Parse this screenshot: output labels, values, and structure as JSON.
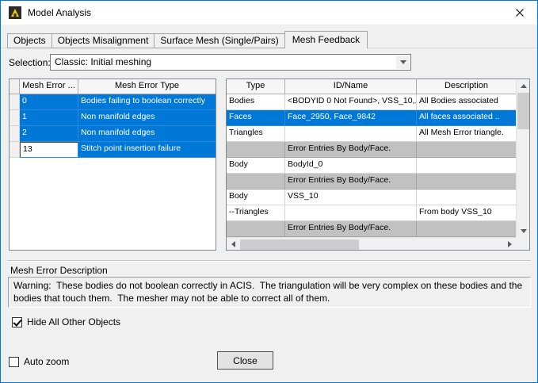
{
  "window": {
    "title": "Model Analysis"
  },
  "tabs": [
    {
      "label": "Objects",
      "active": false
    },
    {
      "label": "Objects Misalignment",
      "active": false
    },
    {
      "label": "Surface Mesh (Single/Pairs)",
      "active": false
    },
    {
      "label": "Mesh Feedback",
      "active": true
    }
  ],
  "selection": {
    "label": "Selection:",
    "value": "Classic: Initial meshing"
  },
  "left_table": {
    "headers": [
      "Mesh Error ...",
      "Mesh Error Type"
    ],
    "rows": [
      {
        "id": "0",
        "type": "Bodies failing to boolean correctly",
        "selected": true
      },
      {
        "id": "1",
        "type": "Non manifold edges",
        "selected": true
      },
      {
        "id": "2",
        "type": "Non manifold edges",
        "selected": true
      },
      {
        "id": "13",
        "type": "Stitch point insertion failure",
        "selected": true
      }
    ]
  },
  "right_table": {
    "headers": [
      "Type",
      "ID/Name",
      "Description"
    ],
    "rows": [
      {
        "type": "Bodies",
        "id": "<BODYID 0 Not Found>, VSS_10,...",
        "desc": "All Bodies associated",
        "state": "normal"
      },
      {
        "type": "Faces",
        "id": "Face_2950, Face_9842",
        "desc": "All faces associated ..",
        "state": "selected"
      },
      {
        "type": "Triangles",
        "id": "",
        "desc": "All Mesh Error triangle.",
        "state": "normal"
      },
      {
        "type": "",
        "id": "Error Entries By Body/Face.",
        "desc": "",
        "state": "section"
      },
      {
        "type": "Body",
        "id": "BodyId_0",
        "desc": "",
        "state": "normal"
      },
      {
        "type": "",
        "id": "Error Entries By Body/Face.",
        "desc": "",
        "state": "section"
      },
      {
        "type": "Body",
        "id": "VSS_10",
        "desc": "",
        "state": "normal"
      },
      {
        "type": "--Triangles",
        "id": "",
        "desc": "From body VSS_10",
        "state": "normal"
      },
      {
        "type": "",
        "id": "Error Entries By Body/Face.",
        "desc": "",
        "state": "section"
      }
    ]
  },
  "description": {
    "label": "Mesh Error Description",
    "text": "Warning:  These bodies do not boolean correctly in ACIS.  The triangulation will be very complex on these bodies and the bodies that touch them.  The mesher may not be able to correct all of them."
  },
  "checkboxes": {
    "hide_all": {
      "label": "Hide All Other Objects",
      "checked": true
    },
    "auto_zoom": {
      "label": "Auto zoom",
      "checked": false
    }
  },
  "buttons": {
    "close": "Close"
  },
  "colors": {
    "selection_blue": "#0078d7",
    "section_row_gray": "#c1c1c1",
    "window_border": "#0078d7"
  }
}
